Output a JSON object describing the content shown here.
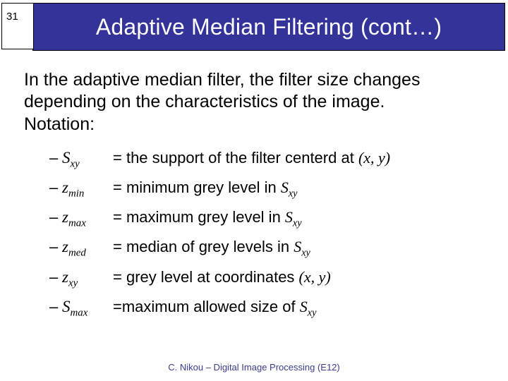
{
  "page_number": "31",
  "title": "Adaptive Median Filtering (cont…)",
  "intro_line1": "In the adaptive median filter, the filter size changes depending on the characteristics of the image.",
  "intro_line2": "Notation:",
  "defs": {
    "sxy": {
      "sym_main": "S",
      "sym_sub": "xy",
      "text_pre": "= the support of the filter centerd at ",
      "coord": "(x, y)"
    },
    "zmin": {
      "sym_main": "z",
      "sym_sub": "min",
      "text_pre": "= minimum grey level in ",
      "ref_main": "S",
      "ref_sub": "xy"
    },
    "zmax": {
      "sym_main": "z",
      "sym_sub": "max",
      "text_pre": "= maximum grey level in ",
      "ref_main": "S",
      "ref_sub": "xy"
    },
    "zmed": {
      "sym_main": "z",
      "sym_sub": "med",
      "text_pre": "= median of grey levels in ",
      "ref_main": "S",
      "ref_sub": "xy"
    },
    "zxy": {
      "sym_main": "z",
      "sym_sub": "xy",
      "text_pre": "= grey level at coordinates ",
      "coord": "(x, y)"
    },
    "smax": {
      "sym_main": "S",
      "sym_sub": "max",
      "text_pre": "=maximum allowed size of ",
      "ref_main": "S",
      "ref_sub": "xy"
    }
  },
  "footer": "C. Nikou – Digital Image Processing (E12)"
}
